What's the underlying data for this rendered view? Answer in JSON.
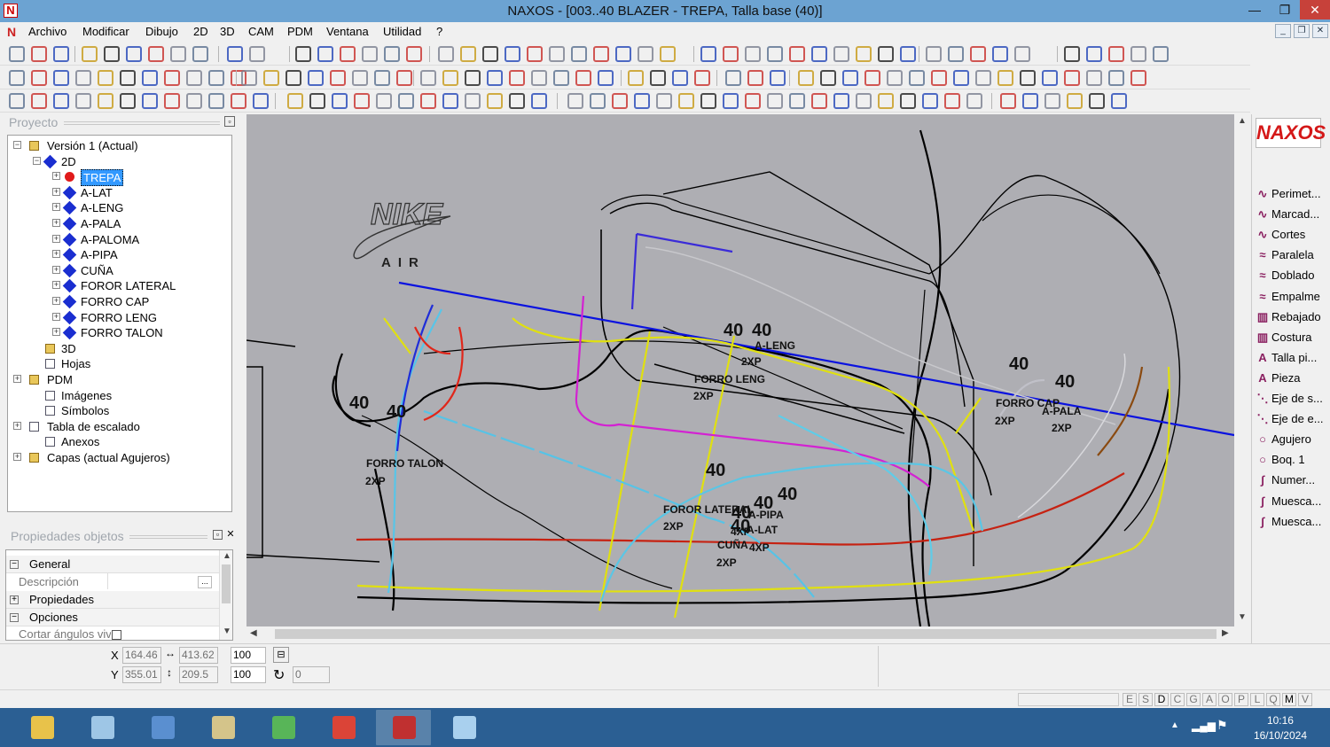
{
  "window": {
    "title": "NAXOS - [003..40 BLAZER - TREPA, Talla base (40)]",
    "logo": "N",
    "controls": [
      "—",
      "❐",
      "✕"
    ]
  },
  "menu": [
    "Archivo",
    "Modificar",
    "Dibujo",
    "2D",
    "3D",
    "CAM",
    "PDM",
    "Ventana",
    "Utilidad",
    "?"
  ],
  "mdi_controls": [
    "_",
    "❐",
    "✕"
  ],
  "project": {
    "header": "Proyecto",
    "tree": [
      {
        "label": "Versión 1 (Actual)",
        "level": 0,
        "icon": "version-icon",
        "exp": "−"
      },
      {
        "label": "2D",
        "level": 1,
        "icon": "layer-2d-icon",
        "exp": "−"
      },
      {
        "label": "TREPA",
        "level": 2,
        "icon": "red-dot-icon",
        "exp": "+",
        "selected": true
      },
      {
        "label": "A-LAT",
        "level": 2,
        "icon": "blue-diamond-icon",
        "exp": "+"
      },
      {
        "label": "A-LENG",
        "level": 2,
        "icon": "blue-diamond-icon",
        "exp": "+"
      },
      {
        "label": "A-PALA",
        "level": 2,
        "icon": "blue-diamond-icon",
        "exp": "+"
      },
      {
        "label": "A-PALOMA",
        "level": 2,
        "icon": "blue-diamond-icon",
        "exp": "+"
      },
      {
        "label": "A-PIPA",
        "level": 2,
        "icon": "blue-diamond-icon",
        "exp": "+"
      },
      {
        "label": "CUÑA",
        "level": 2,
        "icon": "blue-diamond-icon",
        "exp": "+"
      },
      {
        "label": "FOROR LATERAL",
        "level": 2,
        "icon": "blue-diamond-icon",
        "exp": "+"
      },
      {
        "label": "FORRO CAP",
        "level": 2,
        "icon": "blue-diamond-icon",
        "exp": "+"
      },
      {
        "label": "FORRO LENG",
        "level": 2,
        "icon": "blue-diamond-icon",
        "exp": "+"
      },
      {
        "label": "FORRO TALON",
        "level": 2,
        "icon": "blue-diamond-icon",
        "exp": "+"
      },
      {
        "label": "3D",
        "level": 1,
        "icon": "3d-icon",
        "exp": ""
      },
      {
        "label": "Hojas",
        "level": 1,
        "icon": "sheets-icon",
        "exp": ""
      },
      {
        "label": "PDM",
        "level": 0,
        "icon": "folder-icon",
        "exp": "+"
      },
      {
        "label": "Imágenes",
        "level": 1,
        "icon": "images-icon",
        "exp": ""
      },
      {
        "label": "Símbolos",
        "level": 1,
        "icon": "symbols-icon",
        "exp": ""
      },
      {
        "label": "Tabla de escalado",
        "level": 0,
        "icon": "scale-table-icon",
        "exp": "+"
      },
      {
        "label": "Anexos",
        "level": 1,
        "icon": "attachment-icon",
        "exp": ""
      },
      {
        "label": "Capas (actual Agujeros)",
        "level": 0,
        "icon": "layers-icon",
        "exp": "+"
      }
    ]
  },
  "properties": {
    "header": "Propiedades objetos",
    "rows": [
      {
        "label": "General",
        "type": "group",
        "exp": "−"
      },
      {
        "label": "Descripción",
        "type": "field",
        "value": "..."
      },
      {
        "label": "Propiedades",
        "type": "group",
        "exp": "+"
      },
      {
        "label": "Opciones",
        "type": "group",
        "exp": "−"
      },
      {
        "label": "Cortar ángulos vivos",
        "type": "check"
      }
    ]
  },
  "canvas": {
    "labels": [
      {
        "text": "40",
        "big": true
      },
      {
        "text": "40",
        "big": true
      },
      {
        "text": "40",
        "big": true
      },
      {
        "text": "40",
        "big": true
      },
      {
        "text": "40",
        "big": true
      },
      {
        "text": "40",
        "big": true
      },
      {
        "text": "40",
        "big": true
      },
      {
        "text": "40",
        "big": true
      },
      {
        "text": "40",
        "big": true
      },
      {
        "text": "40",
        "big": true
      },
      {
        "text": "40",
        "big": true
      },
      {
        "text": "A-LENG"
      },
      {
        "text": "2XP"
      },
      {
        "text": "FORRO LENG"
      },
      {
        "text": "2XP"
      },
      {
        "text": "FORRO CAP"
      },
      {
        "text": "2XP"
      },
      {
        "text": "A-PALA"
      },
      {
        "text": "2XP"
      },
      {
        "text": "FORRO TALON"
      },
      {
        "text": "2XP"
      },
      {
        "text": "FOROR LATERAL"
      },
      {
        "text": "2XP"
      },
      {
        "text": "A-PIPA"
      },
      {
        "text": "4XP"
      },
      {
        "text": "A-LAT"
      },
      {
        "text": "CUÑA"
      },
      {
        "text": "4XP"
      },
      {
        "text": "2XP"
      }
    ],
    "brand": {
      "name": "NIKE",
      "sub": "AIR"
    }
  },
  "right_panel": {
    "logo": "NAXOS",
    "items": [
      {
        "label": "Perimet...",
        "icon": "perimeter-icon"
      },
      {
        "label": "Marcad...",
        "icon": "marker-icon"
      },
      {
        "label": "Cortes",
        "icon": "cuts-icon"
      },
      {
        "label": "Paralela",
        "icon": "parallel-icon"
      },
      {
        "label": "Doblado",
        "icon": "fold-icon"
      },
      {
        "label": "Empalme",
        "icon": "joint-icon"
      },
      {
        "label": "Rebajado",
        "icon": "skive-icon"
      },
      {
        "label": "Costura",
        "icon": "seam-icon"
      },
      {
        "label": "Talla pi...",
        "icon": "size-text-icon"
      },
      {
        "label": "Pieza",
        "icon": "piece-text-icon"
      },
      {
        "label": "Eje de s...",
        "icon": "axis-icon"
      },
      {
        "label": "Eje de e...",
        "icon": "axis2-icon"
      },
      {
        "label": "Agujero",
        "icon": "hole-icon"
      },
      {
        "label": "Boq. 1",
        "icon": "mouth-icon"
      },
      {
        "label": "Numer...",
        "icon": "number-icon"
      },
      {
        "label": "Muesca...",
        "icon": "notch-icon"
      },
      {
        "label": "Muesca...",
        "icon": "notch2-icon"
      }
    ]
  },
  "coords": {
    "x_label": "X",
    "y_label": "Y",
    "x": "164.46",
    "y": "355.01",
    "width": "413.62",
    "height": "209.5",
    "scale_x": "100",
    "scale_y": "100",
    "angle": "0"
  },
  "status": {
    "letters": [
      "E",
      "S",
      "D",
      "C",
      "G",
      "A",
      "O",
      "P",
      "L",
      "Q",
      "M",
      "V"
    ]
  },
  "taskbar": {
    "apps": [
      {
        "name": "explorer-app",
        "color": "#e8c24a"
      },
      {
        "name": "calculator-app",
        "color": "#9ec6e6"
      },
      {
        "name": "files-app",
        "color": "#5a8fd0"
      },
      {
        "name": "text-app",
        "color": "#d4c48a"
      },
      {
        "name": "green-app",
        "color": "#58b558"
      },
      {
        "name": "chrome-app",
        "color": "#db4437"
      },
      {
        "name": "naxos-app",
        "color": "#c03030"
      },
      {
        "name": "editor-app",
        "color": "#a9d0ee"
      }
    ],
    "time": "10:16",
    "date": "16/10/2024"
  }
}
